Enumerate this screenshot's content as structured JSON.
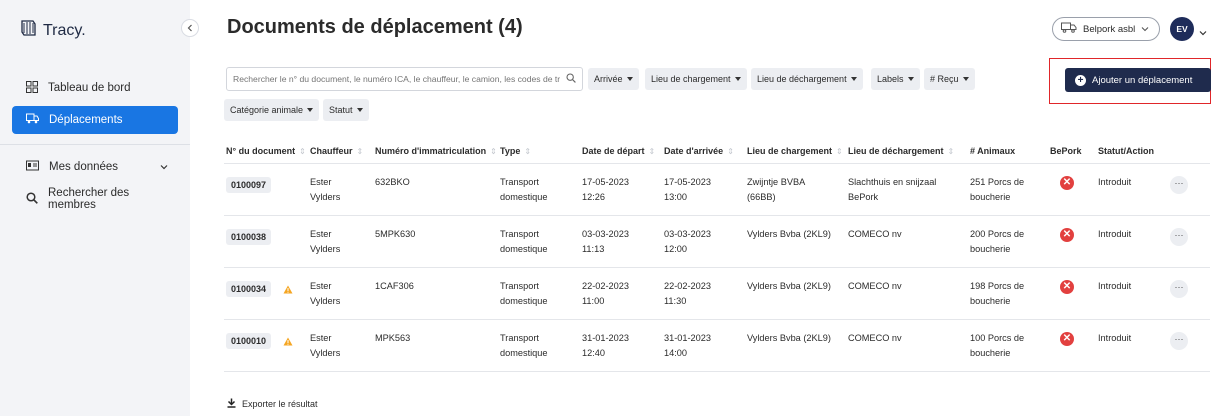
{
  "app": {
    "logo_text": "Tracy."
  },
  "sidebar": {
    "items": [
      {
        "label": "Tableau de bord",
        "icon": "dashboard-icon"
      },
      {
        "label": "Déplacements",
        "icon": "truck-icon",
        "active": true
      },
      {
        "label": "Mes données",
        "icon": "id-card-icon"
      },
      {
        "label": "Rechercher des membres",
        "icon": "search-icon"
      }
    ]
  },
  "header": {
    "title": "Documents de déplacement (4)",
    "org": "Belpork asbl",
    "avatar_initials": "EV"
  },
  "toolbar": {
    "search_placeholder": "Rechercher le n° du document, le numéro ICA, le chauffeur, le camion, les codes de tr",
    "filters": [
      "Arrivée",
      "Lieu de chargement",
      "Lieu de déchargement",
      "Labels",
      "# Reçu",
      "Catégorie animale",
      "Statut"
    ],
    "add_label": "Ajouter un déplacement"
  },
  "table": {
    "headers": [
      "N° du document",
      "Chauffeur",
      "Numéro d'immatriculation",
      "Type",
      "Date de départ",
      "Date d'arrivée",
      "Lieu de chargement",
      "Lieu de déchargement",
      "# Animaux",
      "BePork",
      "Statut/Action"
    ],
    "rows": [
      {
        "doc": "0100097",
        "warning": false,
        "driver_1": "Ester",
        "driver_2": "Vylders",
        "plate": "632BKO",
        "type_1": "Transport",
        "type_2": "domestique",
        "dep_date": "17-05-2023",
        "dep_time": "12:26",
        "arr_date": "17-05-2023",
        "arr_time": "13:00",
        "load_1": "Zwijntje BVBA",
        "load_2": "(66BB)",
        "unload_1": "Slachthuis en snijzaal",
        "unload_2": "BePork",
        "animals_1": "251 Porcs de",
        "animals_2": "boucherie",
        "status": "Introduit"
      },
      {
        "doc": "0100038",
        "warning": false,
        "driver_1": "Ester",
        "driver_2": "Vylders",
        "plate": "5MPK630",
        "type_1": "Transport",
        "type_2": "domestique",
        "dep_date": "03-03-2023",
        "dep_time": "11:13",
        "arr_date": "03-03-2023",
        "arr_time": "12:00",
        "load_1": "Vylders Bvba (2KL9)",
        "load_2": "",
        "unload_1": "COMECO nv",
        "unload_2": "",
        "animals_1": "200 Porcs de",
        "animals_2": "boucherie",
        "status": "Introduit"
      },
      {
        "doc": "0100034",
        "warning": true,
        "driver_1": "Ester",
        "driver_2": "Vylders",
        "plate": "1CAF306",
        "type_1": "Transport",
        "type_2": "domestique",
        "dep_date": "22-02-2023",
        "dep_time": "11:00",
        "arr_date": "22-02-2023",
        "arr_time": "11:30",
        "load_1": "Vylders Bvba (2KL9)",
        "load_2": "",
        "unload_1": "COMECO nv",
        "unload_2": "",
        "animals_1": "198 Porcs de",
        "animals_2": "boucherie",
        "status": "Introduit"
      },
      {
        "doc": "0100010",
        "warning": true,
        "driver_1": "Ester",
        "driver_2": "Vylders",
        "plate": "MPK563",
        "type_1": "Transport",
        "type_2": "domestique",
        "dep_date": "31-01-2023",
        "dep_time": "12:40",
        "arr_date": "31-01-2023",
        "arr_time": "14:00",
        "load_1": "Vylders Bvba (2KL9)",
        "load_2": "",
        "unload_1": "COMECO nv",
        "unload_2": "",
        "animals_1": "100 Porcs de",
        "animals_2": "boucherie",
        "status": "Introduit"
      }
    ]
  },
  "footer": {
    "export_label": "Exporter le résultat"
  },
  "colors": {
    "accent": "#1976e3",
    "primary_dark": "#1f2b4d",
    "danger": "#e2403f",
    "warning": "#f5a623",
    "highlight_box": "#e0262a"
  }
}
